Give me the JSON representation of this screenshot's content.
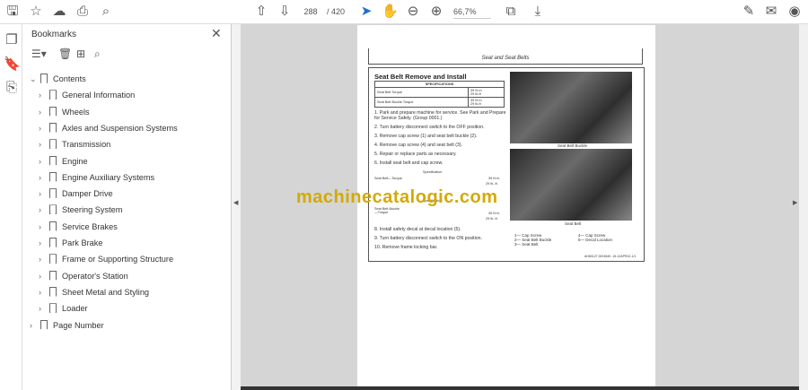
{
  "toolbar": {
    "page_current": "288",
    "page_total": "/ 420",
    "zoom": "66,7%"
  },
  "bookmarks": {
    "title": "Bookmarks",
    "items": [
      {
        "label": "Contents",
        "level": 0,
        "expanded": true
      },
      {
        "label": "General Information",
        "level": 1
      },
      {
        "label": "Wheels",
        "level": 1
      },
      {
        "label": "Axles and Suspension Systems",
        "level": 1
      },
      {
        "label": "Transmission",
        "level": 1
      },
      {
        "label": "Engine",
        "level": 1
      },
      {
        "label": "Engine Auxiliary Systems",
        "level": 1
      },
      {
        "label": "Damper Drive",
        "level": 1
      },
      {
        "label": "Steering System",
        "level": 1
      },
      {
        "label": "Service Brakes",
        "level": 1
      },
      {
        "label": "Park Brake",
        "level": 1
      },
      {
        "label": "Frame or Supporting Structure",
        "level": 1
      },
      {
        "label": "Operator's Station",
        "level": 1
      },
      {
        "label": "Sheet Metal and Styling",
        "level": 1
      },
      {
        "label": "Loader",
        "level": 1
      },
      {
        "label": "Page Number",
        "level": 0
      }
    ]
  },
  "doc": {
    "header": "Seat and Seat Belts",
    "title": "Seat Belt Remove and Install",
    "spec_header": "SPECIFICATIONS",
    "specs": [
      [
        "Seat Belt Torque",
        "39 N·m",
        "29 lb-ft"
      ],
      [
        "Seat Belt Buckle Torque",
        "39 N·m",
        "29 lb-ft"
      ]
    ],
    "steps": [
      "1.  Park and prepare machine for service. See Park and Prepare for Service Safely. (Group 0001.)",
      "2.  Turn battery disconnect switch to the OFF position.",
      "3.  Remove cap screw (1) and seat belt buckle (2).",
      "4.  Remove cap screw (4) and seat belt (3).",
      "5.  Repair or replace parts as necessary.",
      "6.  Install seat belt and cap screw."
    ],
    "spec_label": "Specification",
    "spec1_name": "Seat Belt—Torque",
    "spec1_v1": "39 N·m",
    "spec1_v2": "29 lb.-ft.",
    "spec2_name": "Seat Belt Buckle—Torque",
    "spec2_v1": "39 N·m",
    "spec2_v2": "29 lb.-ft.",
    "steps2": [
      "8.  Install safety decal at decal location (5).",
      "9.  Turn battery disconnect switch to the ON position.",
      "10. Remove frame locking bar."
    ],
    "photo1_caption": "Seat Belt Buckle",
    "photo2_caption": "Seat Belt",
    "legend_left": [
      "1— Cap Screw",
      "2— Seat Belt Buckle",
      "3— Seat Belt"
    ],
    "legend_right": [
      "4— Cap Screw",
      "5— Decal Location"
    ],
    "footer_code": "AH60127,0001840 -19-12APR12-1/1"
  },
  "watermark": "machinecatalogic.com"
}
